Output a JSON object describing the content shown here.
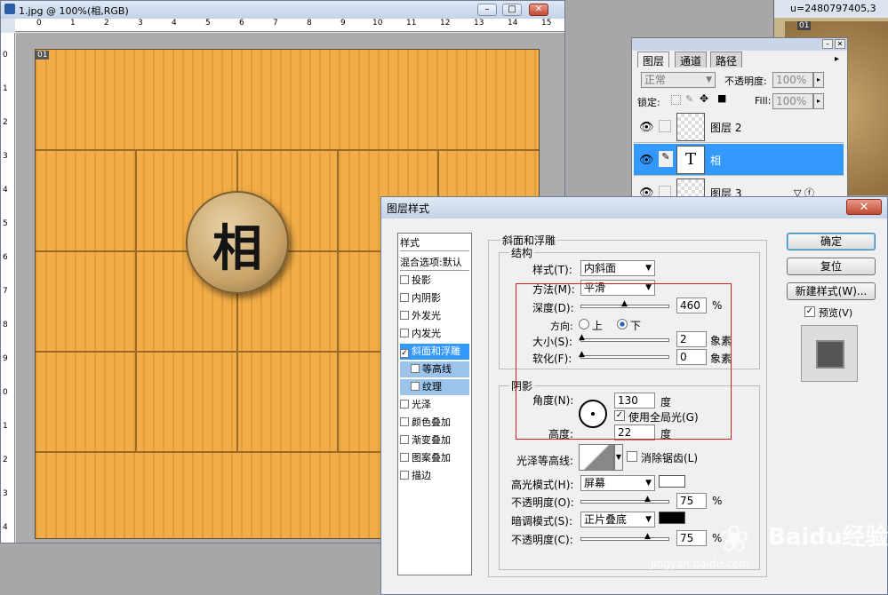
{
  "document": {
    "title": "1.jpg @ 100%(相,RGB)",
    "tab_badge": "01",
    "ruler_top": [
      "0",
      "1",
      "2",
      "3",
      "4",
      "5",
      "6",
      "7",
      "8",
      "9",
      "10",
      "11",
      "12",
      "13",
      "14",
      "15"
    ],
    "ruler_left": [
      "0",
      "1",
      "2",
      "3",
      "4",
      "5",
      "6",
      "7",
      "8",
      "9",
      "0",
      "1",
      "2",
      "3",
      "4"
    ],
    "piece_char": "相"
  },
  "bg_window": {
    "title": "u=2480797405,3",
    "tab_badge": "01"
  },
  "layers_panel": {
    "tabs": [
      "图层",
      "通道",
      "路径"
    ],
    "blend_mode": "正常",
    "opacity_label": "不透明度:",
    "opacity_value": "100%",
    "lock_label": "锁定:",
    "fill_label": "Fill:",
    "fill_value": "100%",
    "layers": [
      {
        "name": "图层 2",
        "selected": false
      },
      {
        "name": "相",
        "selected": true,
        "thumb": "T"
      },
      {
        "name": "图层 3",
        "selected": false
      }
    ]
  },
  "dialog": {
    "title": "图层样式",
    "close_symbol": "✕",
    "styles_header": "样式",
    "style_items": [
      {
        "label": "混合选项:默认",
        "checkbox": false,
        "checked": false
      },
      {
        "label": "投影",
        "checkbox": true,
        "checked": false
      },
      {
        "label": "内阴影",
        "checkbox": true,
        "checked": false
      },
      {
        "label": "外发光",
        "checkbox": true,
        "checked": false
      },
      {
        "label": "内发光",
        "checkbox": true,
        "checked": false
      },
      {
        "label": "斜面和浮雕",
        "checkbox": true,
        "checked": true,
        "active": true
      },
      {
        "label": "等高线",
        "checkbox": true,
        "checked": false,
        "sub": true
      },
      {
        "label": "纹理",
        "checkbox": true,
        "checked": false,
        "sub": true
      },
      {
        "label": "光泽",
        "checkbox": true,
        "checked": false
      },
      {
        "label": "颜色叠加",
        "checkbox": true,
        "checked": false
      },
      {
        "label": "渐变叠加",
        "checkbox": true,
        "checked": false
      },
      {
        "label": "图案叠加",
        "checkbox": true,
        "checked": false
      },
      {
        "label": "描边",
        "checkbox": true,
        "checked": false
      }
    ],
    "section_title": "斜面和浮雕",
    "structure_label": "结构",
    "style_label": "样式(T):",
    "style_value": "内斜面",
    "technique_label": "方法(M):",
    "technique_value": "平滑",
    "depth_label": "深度(D):",
    "depth_value": "460",
    "depth_unit": "%",
    "depth_level": 0.5,
    "direction_label": "方向:",
    "direction_up": "上",
    "direction_down": "下",
    "size_label": "大小(S):",
    "size_value": "2",
    "size_unit": "象素",
    "soften_label": "软化(F):",
    "soften_value": "0",
    "soften_unit": "象素",
    "shading_label": "阴影",
    "angle_label": "角度(N):",
    "angle_value": "130",
    "angle_unit": "度",
    "global_light_label": "使用全局光(G)",
    "altitude_label": "高度:",
    "altitude_value": "22",
    "altitude_unit": "度",
    "gloss_contour_label": "光泽等高线:",
    "anti_alias_label": "消除锯齿(L)",
    "highlight_mode_label": "高光模式(H):",
    "highlight_mode_value": "屏幕",
    "highlight_color": "#ffffff",
    "highlight_opacity_label": "不透明度(O):",
    "highlight_opacity_value": "75",
    "shadow_mode_label": "暗调模式(S):",
    "shadow_mode_value": "正片叠底",
    "shadow_color": "#000000",
    "shadow_opacity_label": "不透明度(C):",
    "shadow_opacity_value": "75",
    "percent": "%",
    "ok_button": "确定",
    "reset_button": "复位",
    "new_style_button": "新建样式(W)...",
    "preview_label": "预览(V)"
  },
  "watermark": {
    "brand": "Baidu经验",
    "url": "jingyan.baidu.com"
  },
  "colors": {
    "accent": "#3399ff",
    "board": "#f2ad48",
    "highlight_box": "#d02020"
  }
}
